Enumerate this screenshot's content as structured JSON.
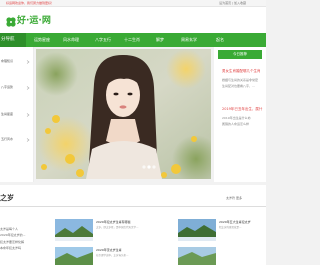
{
  "topbar": {
    "notice": "好运网欢迎你，我们努力做到更好！",
    "links": "设为首页 | 加入收藏"
  },
  "header": {
    "site_name": "好·运·网"
  },
  "nav": {
    "home_label": "分导航",
    "items": [
      "运势星座",
      "风水命理",
      "八字五行",
      "十二生肖",
      "解梦",
      "周易玄学",
      "起名"
    ]
  },
  "sidebar": {
    "items": [
      "命理知识",
      "八字运势",
      "生肖星座",
      "五行风水"
    ]
  },
  "hero": {
    "subject": "portrait of a young woman among yellow flowers"
  },
  "right_panel": {
    "heading": "今日推荐",
    "title_1": "男女生肖婚配哪几个生肖",
    "lines_1": [
      "婚姻与生肖的关系是非常密",
      "生肖配对也要看八字，..."
    ],
    "title_2": "2019年已丑年出生，属什",
    "lines_2": [
      "2019年出生是什么命",
      "属猪的人命运怎么样"
    ]
  },
  "section": {
    "title": "之岁",
    "links": "太岁符   更多"
  },
  "list": {
    "lines": [
      "太岁是每个人",
      "2020年犯太岁的...",
      "犯太岁要怎样化解",
      "本命年犯太岁吗"
    ]
  },
  "cards": [
    {
      "title": "2020年犯太岁生肖有哪些",
      "subtitle": "太岁，即太岁星，是中国古代天文学..."
    },
    {
      "title": "2020年害太岁生肖",
      "subtitle": "在命理学说中，太岁当头坐..."
    },
    {
      "title": "2020年五大生肖犯太岁",
      "subtitle": "犯太岁的意思就是..."
    }
  ],
  "colors": {
    "brand": "#3aaa35",
    "brand_dark": "#2e8f2a",
    "accent_red": "#e04040"
  }
}
